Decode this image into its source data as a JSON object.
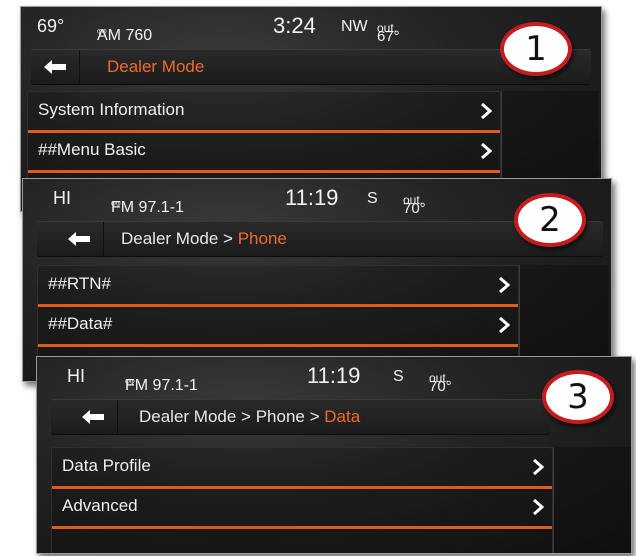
{
  "screens": [
    {
      "status": {
        "temp_set": "69°",
        "radio": "AM 760",
        "time": "3:24",
        "compass": "NW",
        "outside_temp": "67°",
        "outside_label": "out."
      },
      "breadcrumb": {
        "prefix": "",
        "current": "Dealer Mode"
      },
      "items": [
        {
          "label": "System Information"
        },
        {
          "label": "##Menu Basic"
        }
      ],
      "step": "1"
    },
    {
      "status": {
        "temp_set": "HI",
        "radio": "FM 97.1-1",
        "time": "11:19",
        "compass": "S",
        "outside_temp": "70°",
        "outside_label": "out."
      },
      "breadcrumb": {
        "prefix": "Dealer Mode > ",
        "current": "Phone"
      },
      "items": [
        {
          "label": "##RTN#"
        },
        {
          "label": "##Data#"
        }
      ],
      "step": "2"
    },
    {
      "status": {
        "temp_set": "HI",
        "radio": "FM 97.1-1",
        "time": "11:19",
        "compass": "S",
        "outside_temp": "70°",
        "outside_label": "out."
      },
      "breadcrumb": {
        "prefix": "Dealer Mode > Phone > ",
        "current": "Data"
      },
      "items": [
        {
          "label": "Data Profile"
        },
        {
          "label": "Advanced"
        }
      ],
      "step": "3"
    }
  ],
  "colors": {
    "accent": "#e05a1a",
    "breadcrumb_current": "#f06a2a",
    "badge_ring": "#c51d1d"
  },
  "icons": {
    "back": "left-arrow-icon",
    "chevron": "chevron-right-icon",
    "radio": "antenna-icon"
  }
}
